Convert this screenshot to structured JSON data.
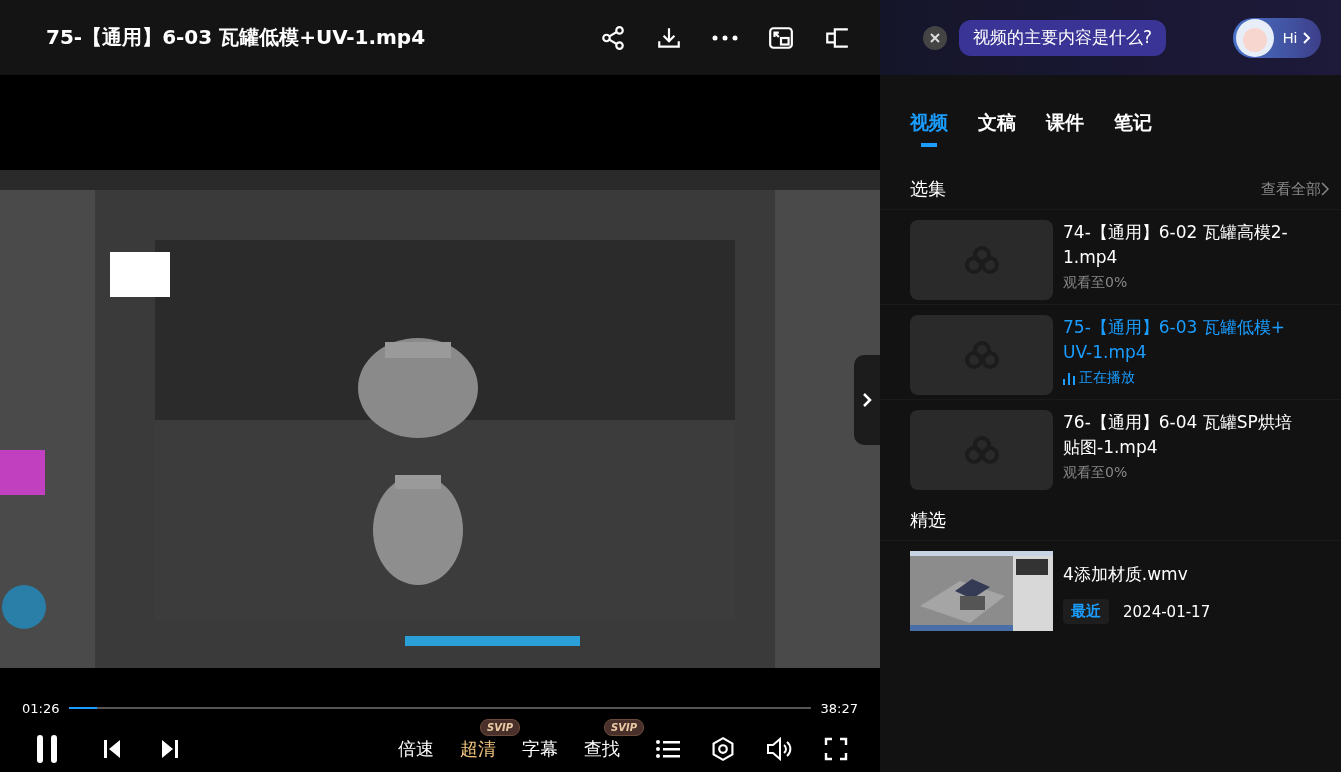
{
  "header": {
    "title": "75-【通用】6-03 瓦罐低模+UV-1.mp4"
  },
  "assistant": {
    "question": "视频的主要内容是什么?",
    "greeting": "Hi"
  },
  "tabs": [
    {
      "label": "视频",
      "selected": true
    },
    {
      "label": "文稿",
      "selected": false
    },
    {
      "label": "课件",
      "selected": false
    },
    {
      "label": "笔记",
      "selected": false
    }
  ],
  "episodes": {
    "title": "选集",
    "view_all": "查看全部",
    "items": [
      {
        "title": "74-【通用】6-02 瓦罐高模2-1.mp4",
        "status": "观看至0%",
        "playing": false
      },
      {
        "title": "75-【通用】6-03 瓦罐低模+UV-1.mp4",
        "status": "正在播放",
        "playing": true
      },
      {
        "title": "76-【通用】6-04 瓦罐SP烘培贴图-1.mp4",
        "status": "观看至0%",
        "playing": false
      }
    ]
  },
  "featured": {
    "title": "精选",
    "items": [
      {
        "title": "4添加材质.wmv",
        "tag": "最近",
        "date": "2024-01-17"
      }
    ]
  },
  "player": {
    "elapsed": "01:26",
    "duration": "38:27",
    "level": 0.037,
    "playing": true,
    "options": [
      {
        "label": "倍速",
        "highlighted": false
      },
      {
        "label": "超清",
        "highlighted": true,
        "badge": "SVIP"
      },
      {
        "label": "字幕",
        "highlighted": false
      },
      {
        "label": "查找",
        "highlighted": false,
        "badge": "SVIP"
      }
    ]
  }
}
